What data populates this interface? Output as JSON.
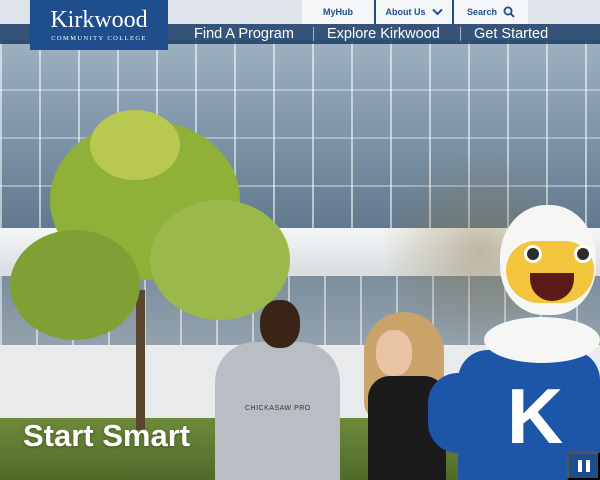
{
  "logo": {
    "name": "Kirkwood",
    "subtitle": "COMMUNITY COLLEGE"
  },
  "utility_nav": {
    "myhub": "MyHub",
    "about": "About Us",
    "search": "Search"
  },
  "main_nav": {
    "find_program": "Find A Program",
    "explore": "Explore Kirkwood",
    "get_started": "Get Started"
  },
  "hero": {
    "headline": "Start Smart",
    "shirt_text": "CHICKASAW PRO",
    "mascot_letter": "K"
  },
  "colors": {
    "brand_blue": "#1f4e8c",
    "nav_bar": "#113460",
    "utility_bg": "#f4f6f8"
  },
  "icons": {
    "about_chevron": "chevron-down-icon",
    "search": "search-icon",
    "pause": "pause-icon"
  }
}
